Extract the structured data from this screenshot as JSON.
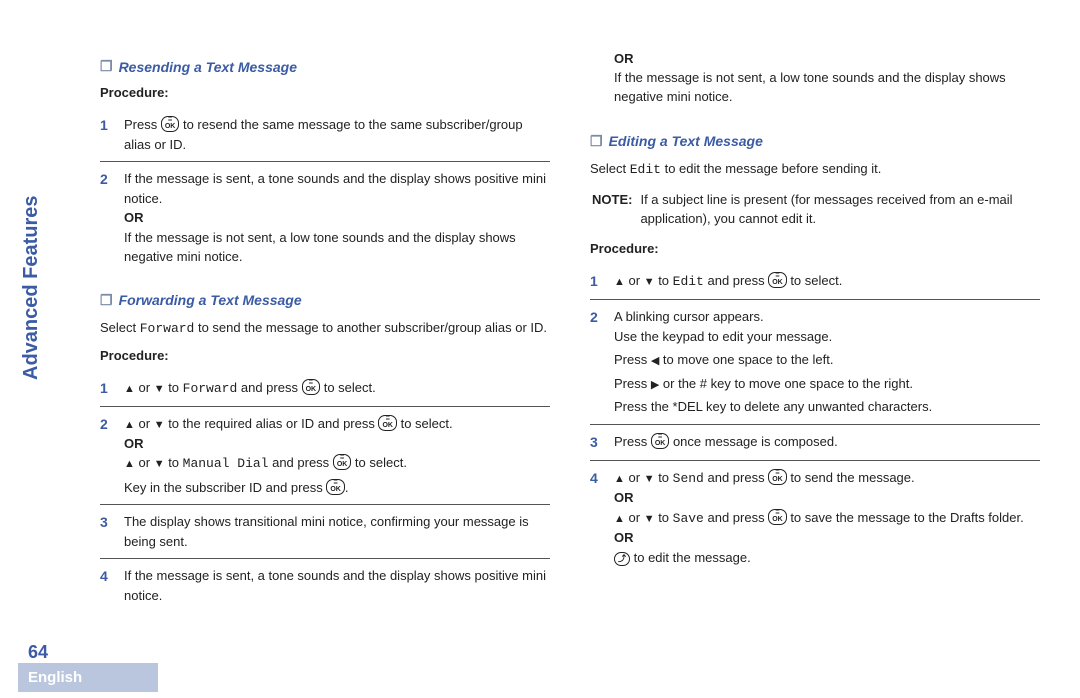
{
  "sidebar_title": "Advanced Features",
  "page_number": "64",
  "language": "English",
  "left": {
    "sec1": {
      "title": "Resending a Text Message",
      "proc": "Procedure:",
      "s1a": "Press ",
      "s1b": " to resend the same message to the same subscriber/group alias or ID.",
      "s2a": "If the message is sent, a tone sounds and the display shows positive mini notice.",
      "s2or": "OR",
      "s2b": "If the message is not sent, a low tone sounds and the display shows negative mini notice."
    },
    "sec2": {
      "title": "Forwarding a Text Message",
      "intro_a": "Select ",
      "intro_code": "Forward",
      "intro_b": " to send the message to another subscriber/group alias or ID.",
      "proc": "Procedure:",
      "s1_or": " or ",
      "s1_to": " to ",
      "s1_code": "Forward",
      "s1_press": " and press ",
      "s1_sel": " to select.",
      "s2a_or": " or ",
      "s2a_mid": " to the required alias or ID and press ",
      "s2a_sel": " to select.",
      "s2or": "OR",
      "s2b_or": " or ",
      "s2b_to": " to ",
      "s2b_code": "Manual Dial",
      "s2b_press": " and press ",
      "s2b_sel": " to select.",
      "s2c_a": "Key in the subscriber ID and press ",
      "s2c_b": ".",
      "s3": "The display shows transitional mini notice, confirming your message is being sent.",
      "s4": "If the message is sent, a tone sounds and the display shows positive mini notice."
    }
  },
  "right": {
    "top_or": "OR",
    "top_txt": "If the message is not sent, a low tone sounds and the display shows negative mini notice.",
    "sec3": {
      "title": "Editing a Text Message",
      "intro_a": "Select ",
      "intro_code": "Edit",
      "intro_b": " to edit the message before sending it.",
      "note_label": "NOTE:",
      "note_txt": "If a subject line is present (for messages received from an e-mail application), you cannot edit it.",
      "proc": "Procedure:",
      "s1_or": " or ",
      "s1_to": " to ",
      "s1_code": "Edit",
      "s1_press": " and press ",
      "s1_sel": " to select.",
      "s2a": "A blinking cursor appears.",
      "s2b": "Use the keypad to edit your message.",
      "s2c_a": "Press ",
      "s2c_b": " to move one space to the left.",
      "s2d_a": "Press ",
      "s2d_b": " or the # key to move one space to the right.",
      "s2e": "Press the *DEL key to delete any unwanted characters.",
      "s3a": "Press ",
      "s3b": " once message is composed.",
      "s4a_or": " or ",
      "s4a_to": " to ",
      "s4a_code": "Send",
      "s4a_press": " and press ",
      "s4a_end": " to send the message.",
      "s4or1": "OR",
      "s4b_or": " or ",
      "s4b_to": " to ",
      "s4b_code": "Save",
      "s4b_press": " and press ",
      "s4b_end": " to save the message to the Drafts folder.",
      "s4or2": "OR",
      "s4c": " to edit the message."
    }
  }
}
